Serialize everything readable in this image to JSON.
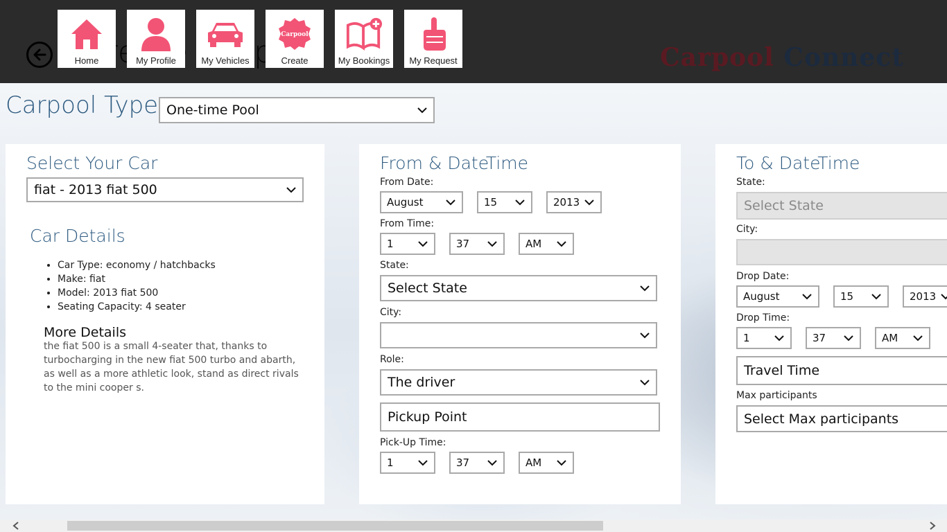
{
  "header": {
    "ghost_title": "Create Carpool",
    "brand_part1": "Carpool",
    "brand_part2": "Connect",
    "nav": [
      {
        "label": "Home",
        "icon": "home-icon"
      },
      {
        "label": "My Profile",
        "icon": "person-icon"
      },
      {
        "label": "My Vehicles",
        "icon": "car-icon"
      },
      {
        "label": "Create",
        "icon": "carpool-badge-icon",
        "badge_text": "Carpool"
      },
      {
        "label": "My Bookings",
        "icon": "book-add-icon"
      },
      {
        "label": "My Request",
        "icon": "hand-point-icon"
      }
    ],
    "accent_color": "#f25475"
  },
  "carpool_type": {
    "label": "Carpool Type",
    "value": "One-time Pool"
  },
  "car_panel": {
    "title": "Select Your Car",
    "selected_car": "fiat - 2013 fiat 500",
    "details_title": "Car Details",
    "details": [
      "Car Type: economy / hatchbacks",
      "Make: fiat",
      "Model: 2013 fiat 500",
      "Seating Capacity: 4 seater"
    ],
    "more_title": "More Details",
    "more_text": "the fiat 500 is a small 4-seater that, thanks to turbocharging in the new fiat 500 turbo and abarth, as well as a more athletic look, stand as direct rivals to the mini cooper s."
  },
  "from_panel": {
    "title": "From & DateTime",
    "from_date_label": "From Date:",
    "month": "August",
    "day": "15",
    "year": "2013",
    "from_time_label": "From Time:",
    "hour": "1",
    "minute": "37",
    "ampm": "AM",
    "state_label": "State:",
    "state": "Select State",
    "city_label": "City:",
    "city": "",
    "role_label": "Role:",
    "role": "The driver",
    "pickup_point": "Pickup Point",
    "pickup_time_label": "Pick-Up Time:",
    "pickup_hour": "1",
    "pickup_minute": "37",
    "pickup_ampm": "AM"
  },
  "to_panel": {
    "title": "To & DateTime",
    "state_label": "State:",
    "state": "Select State",
    "city_label": "City:",
    "city": "",
    "drop_date_label": "Drop Date:",
    "month": "August",
    "day": "15",
    "year": "2013",
    "drop_time_label": "Drop Time:",
    "hour": "1",
    "minute": "37",
    "ampm": "AM",
    "travel_time": "Travel Time",
    "max_participants_label": "Max participants",
    "max_participants": "Select Max participants"
  }
}
